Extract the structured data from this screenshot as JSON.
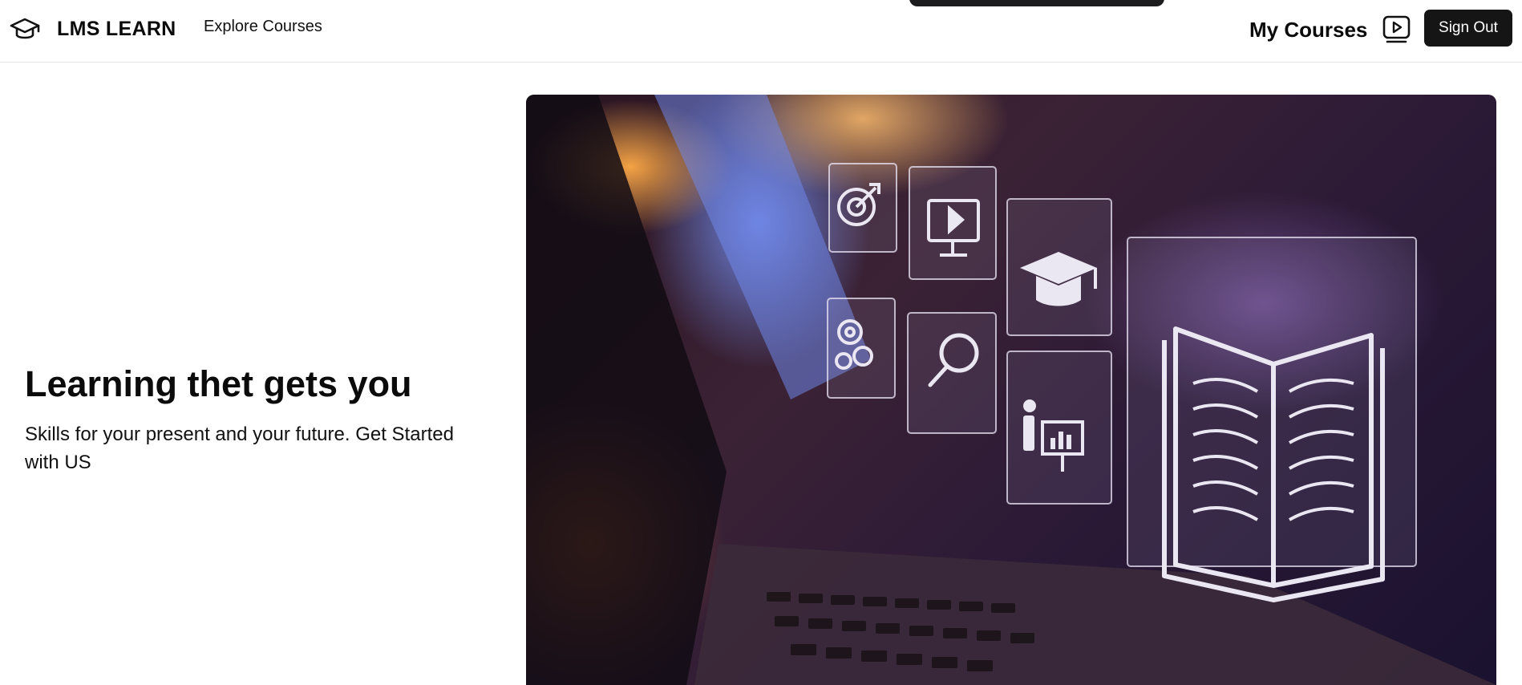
{
  "header": {
    "brand": "LMS LEARN",
    "nav_explore": "Explore Courses",
    "my_courses": "My Courses",
    "sign_out": "Sign Out"
  },
  "hero": {
    "title": "Learning thet gets you",
    "subtitle": "Skills for your present and your future. Get Started with US"
  },
  "icons": {
    "logo": "graduation-cap-icon",
    "my_courses": "play-video-icon"
  },
  "colors": {
    "accent": "#151515",
    "text": "#0b0b0b",
    "border": "#e6e6e6"
  }
}
